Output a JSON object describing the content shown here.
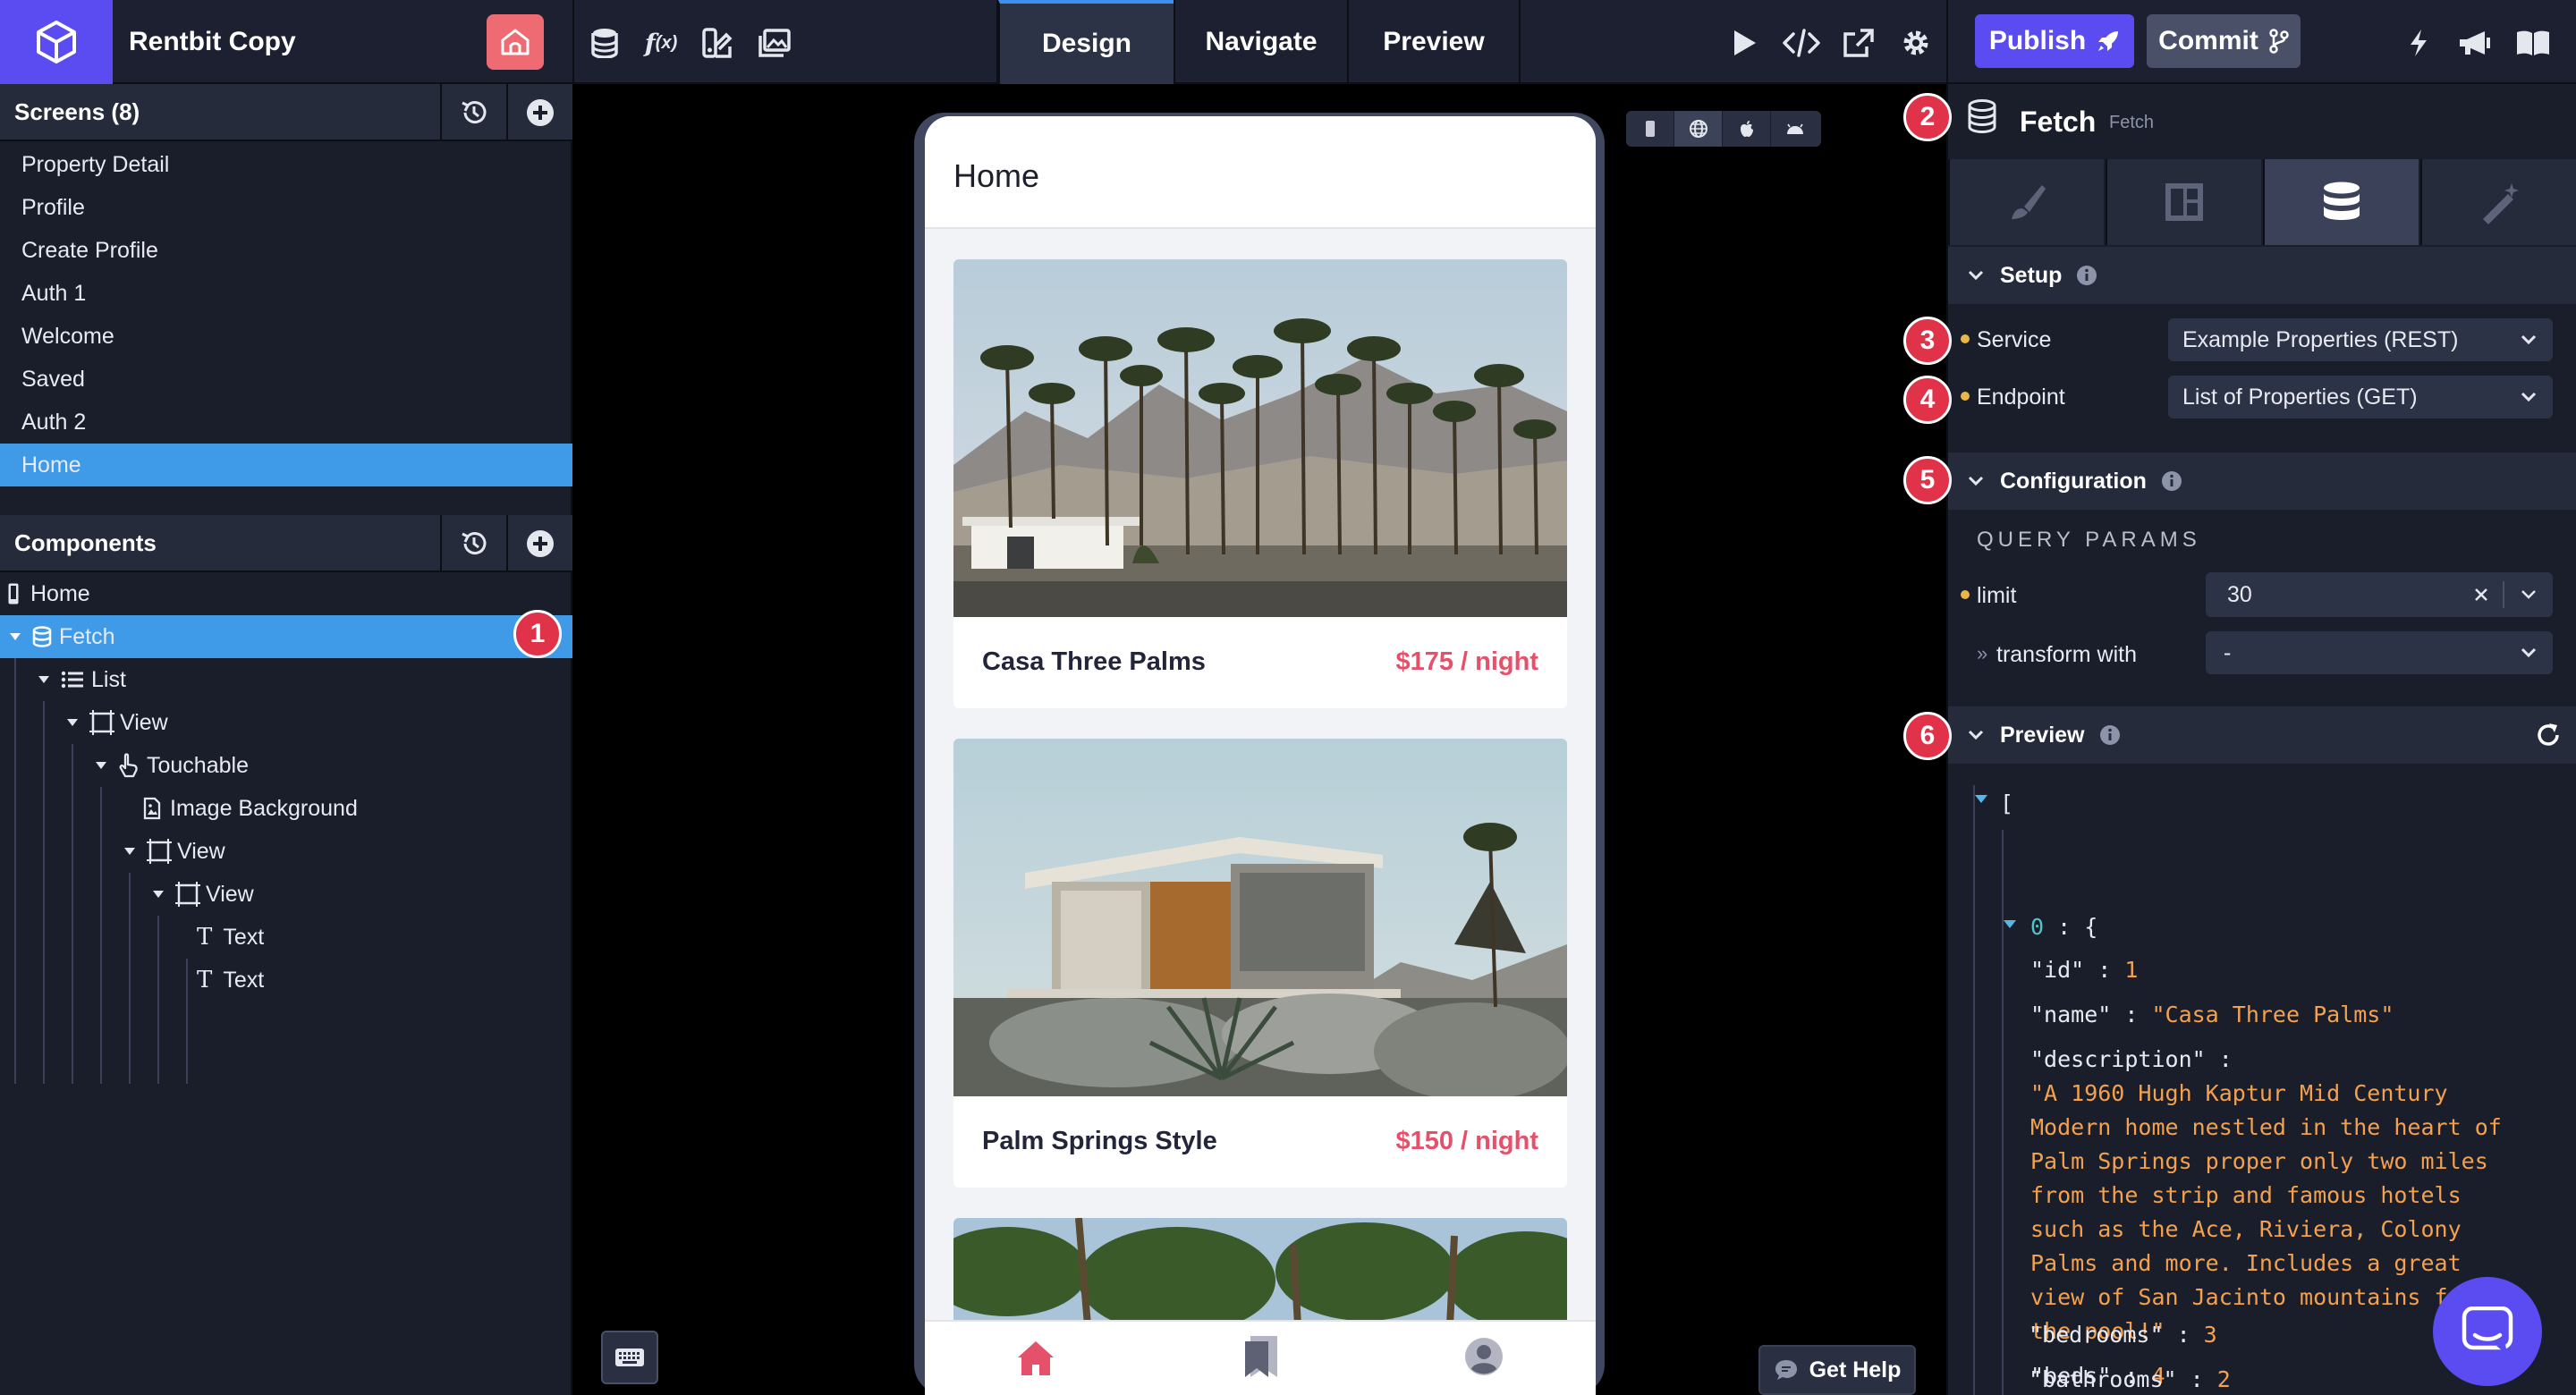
{
  "app": {
    "name": "Rentbit Copy"
  },
  "header": {
    "tabs": [
      {
        "label": "Design"
      },
      {
        "label": "Navigate"
      },
      {
        "label": "Preview"
      }
    ],
    "publish_label": "Publish",
    "commit_label": "Commit"
  },
  "screens": {
    "title": "Screens (8)",
    "items": [
      {
        "label": "Property Detail"
      },
      {
        "label": "Profile"
      },
      {
        "label": "Create Profile"
      },
      {
        "label": "Auth 1"
      },
      {
        "label": "Welcome"
      },
      {
        "label": "Saved"
      },
      {
        "label": "Auth 2"
      },
      {
        "label": "Home",
        "active": true
      }
    ]
  },
  "components": {
    "title": "Components",
    "items": [
      {
        "label": "Home",
        "icon": "phone-icon"
      },
      {
        "label": "Fetch",
        "icon": "database-icon",
        "active": true
      },
      {
        "label": "List",
        "icon": "list-icon"
      },
      {
        "label": "View",
        "icon": "view-icon"
      },
      {
        "label": "Touchable",
        "icon": "pointer-icon"
      },
      {
        "label": "Image Background",
        "icon": "image-icon"
      },
      {
        "label": "View",
        "icon": "view-icon"
      },
      {
        "label": "View",
        "icon": "view-icon"
      },
      {
        "label": "Text",
        "icon": "text-icon"
      },
      {
        "label": "Text",
        "icon": "text-icon"
      }
    ]
  },
  "phone": {
    "title": "Home",
    "cards": [
      {
        "name": "Casa Three Palms",
        "price": "$175 / night"
      },
      {
        "name": "Palm Springs Style",
        "price": "$150 / night"
      }
    ]
  },
  "canvas": {
    "get_help_label": "Get Help"
  },
  "inspector": {
    "title": "Fetch",
    "type": "Fetch",
    "setup": {
      "title": "Setup",
      "service_label": "Service",
      "service_value": "Example Properties (REST)",
      "endpoint_label": "Endpoint",
      "endpoint_value": "List of Properties (GET)"
    },
    "configuration": {
      "title": "Configuration",
      "query_params_label": "QUERY PARAMS",
      "limit_label": "limit",
      "limit_value": "30",
      "transform_label": "transform with",
      "transform_value": "-"
    },
    "preview": {
      "title": "Preview",
      "open_bracket": "[",
      "index_key": "0",
      "index_open": ": {",
      "id_key": "\"id\"",
      "id_value": "1",
      "name_key": "\"name\"",
      "name_value": "\"Casa Three Palms\"",
      "description_key": "\"description\"",
      "description_lines": [
        "\"A 1960 Hugh Kaptur Mid Century",
        "Modern home nestled in the heart of",
        "Palm Springs proper only two miles",
        "from the strip and famous hotels",
        "such as the Ace, Riviera, Colony",
        "Palms and more. Includes a great",
        "view of San Jacinto mountains from",
        "the pool!\""
      ],
      "beds_key": "\"beds\"",
      "beds_value": "4",
      "bedrooms_key": "\"bedrooms\"",
      "bedrooms_value": "3",
      "bathrooms_key": "\"bathrooms\"",
      "bathrooms_value": "2"
    }
  },
  "badges": [
    "1",
    "2",
    "3",
    "4",
    "5",
    "6"
  ],
  "colors": {
    "accent": "#5a4cf0",
    "selection": "#3f9be8",
    "badge": "#e0334a",
    "price": "#e5506a",
    "home_button": "#ee6b73"
  }
}
